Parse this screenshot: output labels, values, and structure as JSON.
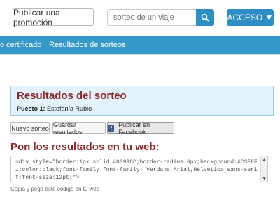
{
  "header": {
    "promo_button": "Publicar una promoción",
    "search_placeholder": "sorteo de un viaje",
    "login_button": "ACCESO ▼"
  },
  "nav": {
    "items": [
      {
        "label": "o certificado"
      },
      {
        "label": "Resultados de sorteos"
      }
    ]
  },
  "results": {
    "title": "Resultados del sorteo",
    "position_label": "Puesto 1:",
    "position_value": "Estefanía Rubio"
  },
  "actions": {
    "new_draw": "Nuevo sorteo",
    "save_results": "Guardar resultados",
    "share_facebook": "Publicar en Facebook"
  },
  "embed": {
    "title": "Pon los resultados en tu web:",
    "code": "<div style=\"border:1px solid #0099CC;border-radius:6px;background:#C3E6F1;color:black;font-family:font-family: Verdana,Arial,Helvetica,sans-serif;font-size:12pt;\">",
    "hint": "Copia y pega este código en tu web"
  },
  "colors": {
    "accent": "#2e8fc4",
    "nav_bg": "#3799c9",
    "title": "#8a2a2a",
    "results_bg": "#e3f2fb"
  }
}
